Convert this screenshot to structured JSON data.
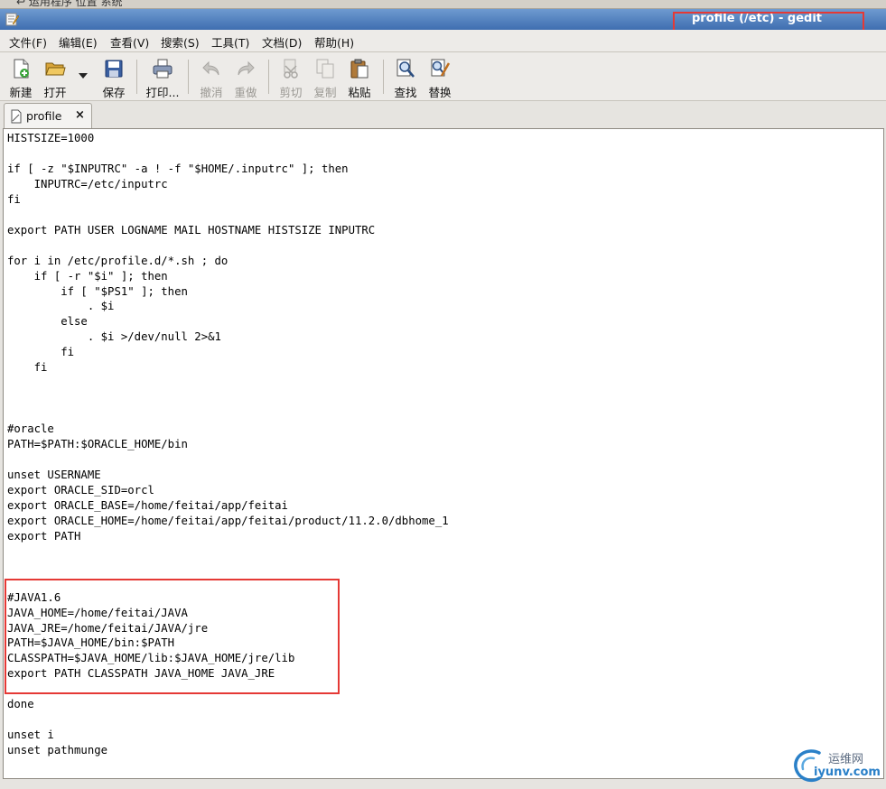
{
  "topstrip": {
    "text": "↩ 运用程序   位置   系统"
  },
  "window": {
    "title": "profile (/etc) - gedit"
  },
  "menu": [
    {
      "label": "文件(F)"
    },
    {
      "label": "编辑(E)"
    },
    {
      "label": "查看(V)"
    },
    {
      "label": "搜索(S)"
    },
    {
      "label": "工具(T)"
    },
    {
      "label": "文档(D)"
    },
    {
      "label": "帮助(H)"
    }
  ],
  "toolbar": {
    "new": "新建",
    "open": "打开",
    "save": "保存",
    "print": "打印...",
    "undo": "撤消",
    "redo": "重做",
    "cut": "剪切",
    "copy": "复制",
    "paste": "粘贴",
    "find": "查找",
    "replace": "替换"
  },
  "tab": {
    "label": "profile",
    "close": "×"
  },
  "editor": {
    "content": "HISTSIZE=1000\n\nif [ -z \"$INPUTRC\" -a ! -f \"$HOME/.inputrc\" ]; then\n    INPUTRC=/etc/inputrc\nfi\n\nexport PATH USER LOGNAME MAIL HOSTNAME HISTSIZE INPUTRC\n\nfor i in /etc/profile.d/*.sh ; do\n    if [ -r \"$i\" ]; then\n        if [ \"$PS1\" ]; then\n            . $i\n        else\n            . $i >/dev/null 2>&1\n        fi\n    fi\n\n\n\n#oracle\nPATH=$PATH:$ORACLE_HOME/bin\n\nunset USERNAME\nexport ORACLE_SID=orcl\nexport ORACLE_BASE=/home/feitai/app/feitai\nexport ORACLE_HOME=/home/feitai/app/feitai/product/11.2.0/dbhome_1\nexport PATH\n\n\n\n#JAVA1.6\nJAVA_HOME=/home/feitai/JAVA\nJAVA_JRE=/home/feitai/JAVA/jre\nPATH=$JAVA_HOME/bin:$PATH\nCLASSPATH=$JAVA_HOME/lib:$JAVA_HOME/jre/lib\nexport PATH CLASSPATH JAVA_HOME JAVA_JRE\n\ndone\n\nunset i\nunset pathmunge"
  },
  "watermark": {
    "line1": "运维网",
    "line2": "iyunv.com"
  },
  "colors": {
    "title_bar": "#4a7abc",
    "highlight": "#e53935"
  }
}
